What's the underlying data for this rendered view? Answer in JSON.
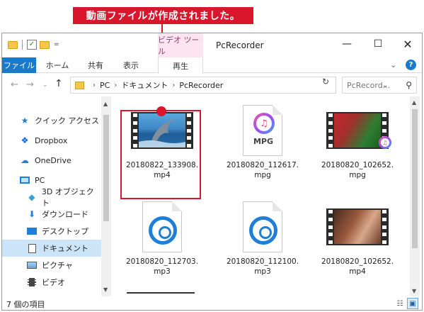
{
  "callout": {
    "text": "動画ファイルが作成されました。"
  },
  "window": {
    "context_tab_title": "ビデオ ツール",
    "title": "PcRecorder",
    "controls": {
      "minimize": "—",
      "maximize": "☐",
      "close": "✕"
    }
  },
  "quick_access_toolbar": {
    "dropdown": "="
  },
  "ribbon": {
    "tabs": [
      {
        "label": "ファイル"
      },
      {
        "label": "ホーム"
      },
      {
        "label": "共有"
      },
      {
        "label": "表示"
      },
      {
        "label": "再生"
      }
    ],
    "expand_glyph": "⌄",
    "help_glyph": "?"
  },
  "nav": {
    "back": "←",
    "forward": "→",
    "recent": "⌄",
    "up": "↑",
    "breadcrumb": [
      "PC",
      "ドキュメント",
      "PcRecorder"
    ],
    "separator": "›",
    "address_dropdown": "⌄",
    "refresh": "↻",
    "search_placeholder": "PcRecord...",
    "search_icon": "⚲"
  },
  "sidebar": {
    "items": [
      {
        "label": "クイック アクセス",
        "icon": "star-icon"
      },
      {
        "label": "Dropbox",
        "icon": "dropbox-icon"
      },
      {
        "label": "OneDrive",
        "icon": "onedrive-icon"
      },
      {
        "label": "PC",
        "icon": "pc-icon"
      },
      {
        "label": "3D オブジェクト",
        "icon": "3d-objects-icon"
      },
      {
        "label": "ダウンロード",
        "icon": "download-icon"
      },
      {
        "label": "デスクトップ",
        "icon": "desktop-icon"
      },
      {
        "label": "ドキュメント",
        "icon": "documents-icon",
        "selected": true
      },
      {
        "label": "ピクチャ",
        "icon": "pictures-icon"
      },
      {
        "label": "ビデオ",
        "icon": "videos-icon"
      }
    ]
  },
  "files": [
    {
      "name": "20180822_133908.mp4",
      "line1": "20180822_133908.",
      "line2": "mp4",
      "kind": "video-dolphin",
      "highlighted": true
    },
    {
      "name": "20180820_112617.mpg",
      "line1": "20180820_112617.",
      "line2": "mpg",
      "kind": "mpg-itunes",
      "badge_text": "MPG"
    },
    {
      "name": "20180820_102652.mpg",
      "line1": "20180820_102652.",
      "line2": "mpg",
      "kind": "video-red-green"
    },
    {
      "name": "20180820_112703.mp3",
      "line1": "20180820_112703.",
      "line2": "mp3",
      "kind": "audio-groove"
    },
    {
      "name": "20180820_112100.mp3",
      "line1": "20180820_112100.",
      "line2": "mp3",
      "kind": "audio-groove"
    },
    {
      "name": "20180820_102652.mp4",
      "line1": "20180820_102652.",
      "line2": "mp4",
      "kind": "video-brown"
    }
  ],
  "status": {
    "item_count": "7 個の項目"
  },
  "colors": {
    "accent": "#1979ca",
    "callout_red": "#d8162c",
    "selected_bg": "#cce4f7",
    "context_tab_bg": "#fce4f0"
  }
}
